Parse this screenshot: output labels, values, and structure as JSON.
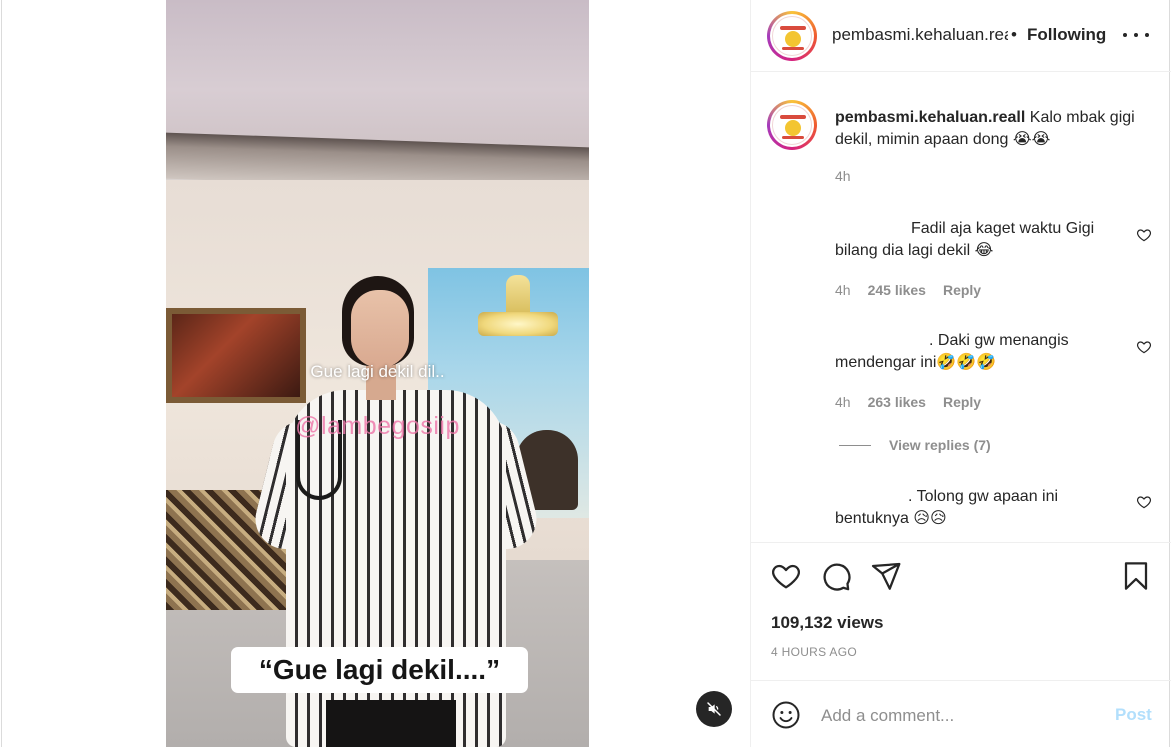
{
  "video": {
    "caption_overlay": "Gue lagi dekil dil..",
    "watermark": "@lambegosiip",
    "subtitle": "“Gue lagi dekil....”",
    "mute_icon": "speaker-muted-icon"
  },
  "header": {
    "username": "pembasmi.kehaluan.reall",
    "separator": "•",
    "follow_status": "Following",
    "more_icon": "more-horizontal-icon"
  },
  "post_caption": {
    "username": "pembasmi.kehaluan.reall",
    "text": "Kalo mbak gigi dekil, mimin apaan dong 😭😭",
    "time": "4h"
  },
  "comments": [
    {
      "text": "Fadil aja kaget waktu Gigi bilang dia lagi dekil 😂",
      "time": "4h",
      "likes": "245 likes",
      "reply_label": "Reply"
    },
    {
      "text": ". Daki gw menangis mendengar ini🤣🤣🤣",
      "time": "4h",
      "likes": "263 likes",
      "reply_label": "Reply",
      "view_replies": "View replies (7)"
    },
    {
      "text": ". Tolong gw apaan ini bentuknya 😥😥"
    }
  ],
  "actions": {
    "icons": [
      "heart-icon",
      "comment-icon",
      "share-icon",
      "bookmark-icon"
    ],
    "views": "109,132 views",
    "posted_ago": "4 HOURS AGO"
  },
  "add_comment": {
    "placeholder": "Add a comment...",
    "post_label": "Post",
    "post_color": "#b2dffc"
  }
}
